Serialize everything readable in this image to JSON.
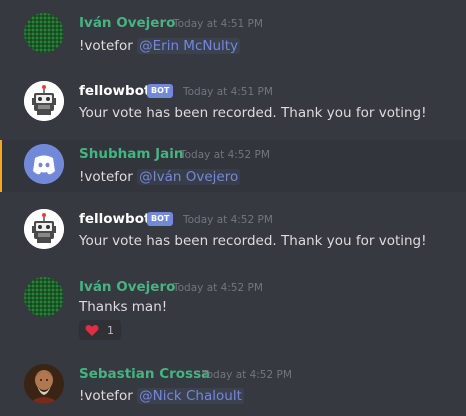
{
  "colors": {
    "background": "#36393f",
    "highlight_bar": "#faa61a",
    "username_green": "#43b581",
    "mention": "#7289da",
    "bot_tag": "#7289da",
    "timestamp": "#72767d",
    "text": "#dcddde"
  },
  "messages": [
    {
      "author": "Iván Ovejero",
      "timestamp": "Today at 4:51 PM",
      "command": "!votefor ",
      "mention": "@Erin McNulty",
      "avatar": "green-pattern-avatar"
    },
    {
      "author": "fellowbot",
      "bot_tag": "BOT",
      "timestamp": "Today at 4:51 PM",
      "text": "Your vote has been recorded. Thank you for voting!",
      "avatar": "robot-avatar"
    },
    {
      "author": "Shubham Jain",
      "timestamp": "Today at 4:52 PM",
      "command": "!votefor ",
      "mention": "@Iván Ovejero",
      "avatar": "discord-logo-avatar",
      "highlighted": true
    },
    {
      "author": "fellowbot",
      "bot_tag": "BOT",
      "timestamp": "Today at 4:52 PM",
      "text": "Your vote has been recorded. Thank you for voting!",
      "avatar": "robot-avatar"
    },
    {
      "author": "Iván Ovejero",
      "timestamp": "Today at 4:52 PM",
      "text": "Thanks man!",
      "avatar": "green-pattern-avatar",
      "reaction": {
        "icon": "heart-icon",
        "count": "1"
      }
    },
    {
      "author": "Sebastian Crossa",
      "timestamp": "Today at 4:52 PM",
      "command": "!votefor ",
      "mention": "@Nick Chaloult",
      "avatar": "portrait-avatar"
    }
  ]
}
